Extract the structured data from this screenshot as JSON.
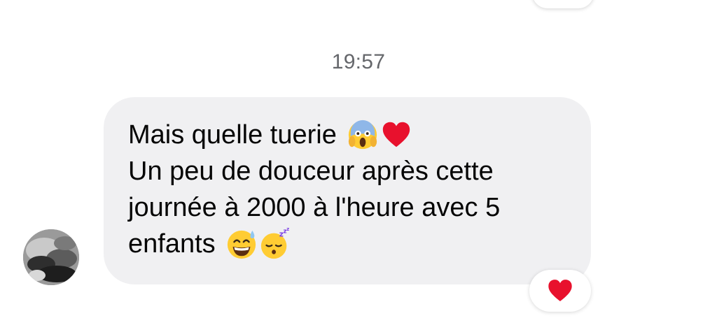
{
  "conversation": {
    "timestamp": "19:57",
    "message": {
      "lines": [
        "Mais quelle tuerie",
        "Un peu de douceur après cette",
        "journée à 2000 à l'heure avec 5",
        "enfants"
      ],
      "emojis": {
        "line1": [
          "face-screaming-in-fear-icon",
          "red-heart-icon"
        ],
        "line4": [
          "grinning-face-with-sweat-icon",
          "sleeping-face-icon"
        ]
      },
      "reactions": [
        "red-heart-icon"
      ]
    },
    "sender_avatar_icon": "avatar-photo"
  },
  "colors": {
    "bubble_bg": "#f0f0f2",
    "text": "#050505",
    "timestamp": "#65676b",
    "heart": "#e8112d"
  }
}
